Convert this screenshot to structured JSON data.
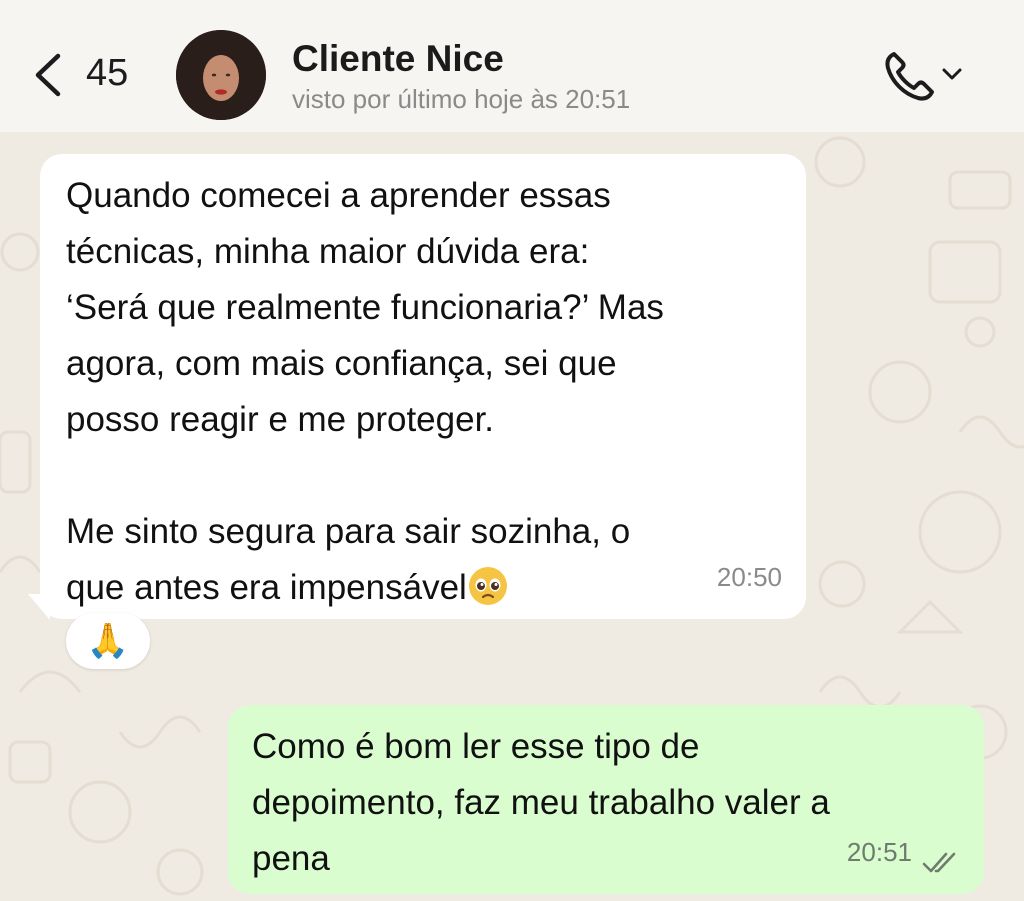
{
  "header": {
    "back_count": "45",
    "contact_name": "Cliente Nice",
    "last_seen": "visto por último hoje às 20:51",
    "icons": {
      "back": "chevron-left-icon",
      "call": "phone-icon",
      "dropdown": "chevron-down-icon"
    }
  },
  "messages": [
    {
      "direction": "incoming",
      "text_line1": "Quando comecei a aprender essas\ntécnicas, minha maior dúvida era:\n‘Será que realmente funcionaria?’ Mas\nagora, com mais confiança, sei que\nposso reagir e me proteger.\n\nMe sinto segura para sair sozinha, o\nque antes era impensável",
      "emoji": "pleading-face-icon",
      "time": "20:50",
      "reaction": "🙏"
    },
    {
      "direction": "outgoing",
      "text": "Como é bom ler esse tipo de\ndepoimento, faz meu trabalho valer a\npena",
      "time": "20:51",
      "status": "read-ticks-icon"
    }
  ],
  "colors": {
    "header_bg": "#f6f5f2",
    "chat_bg": "#efeae2",
    "incoming_bubble": "#ffffff",
    "outgoing_bubble": "#dafdd0"
  }
}
